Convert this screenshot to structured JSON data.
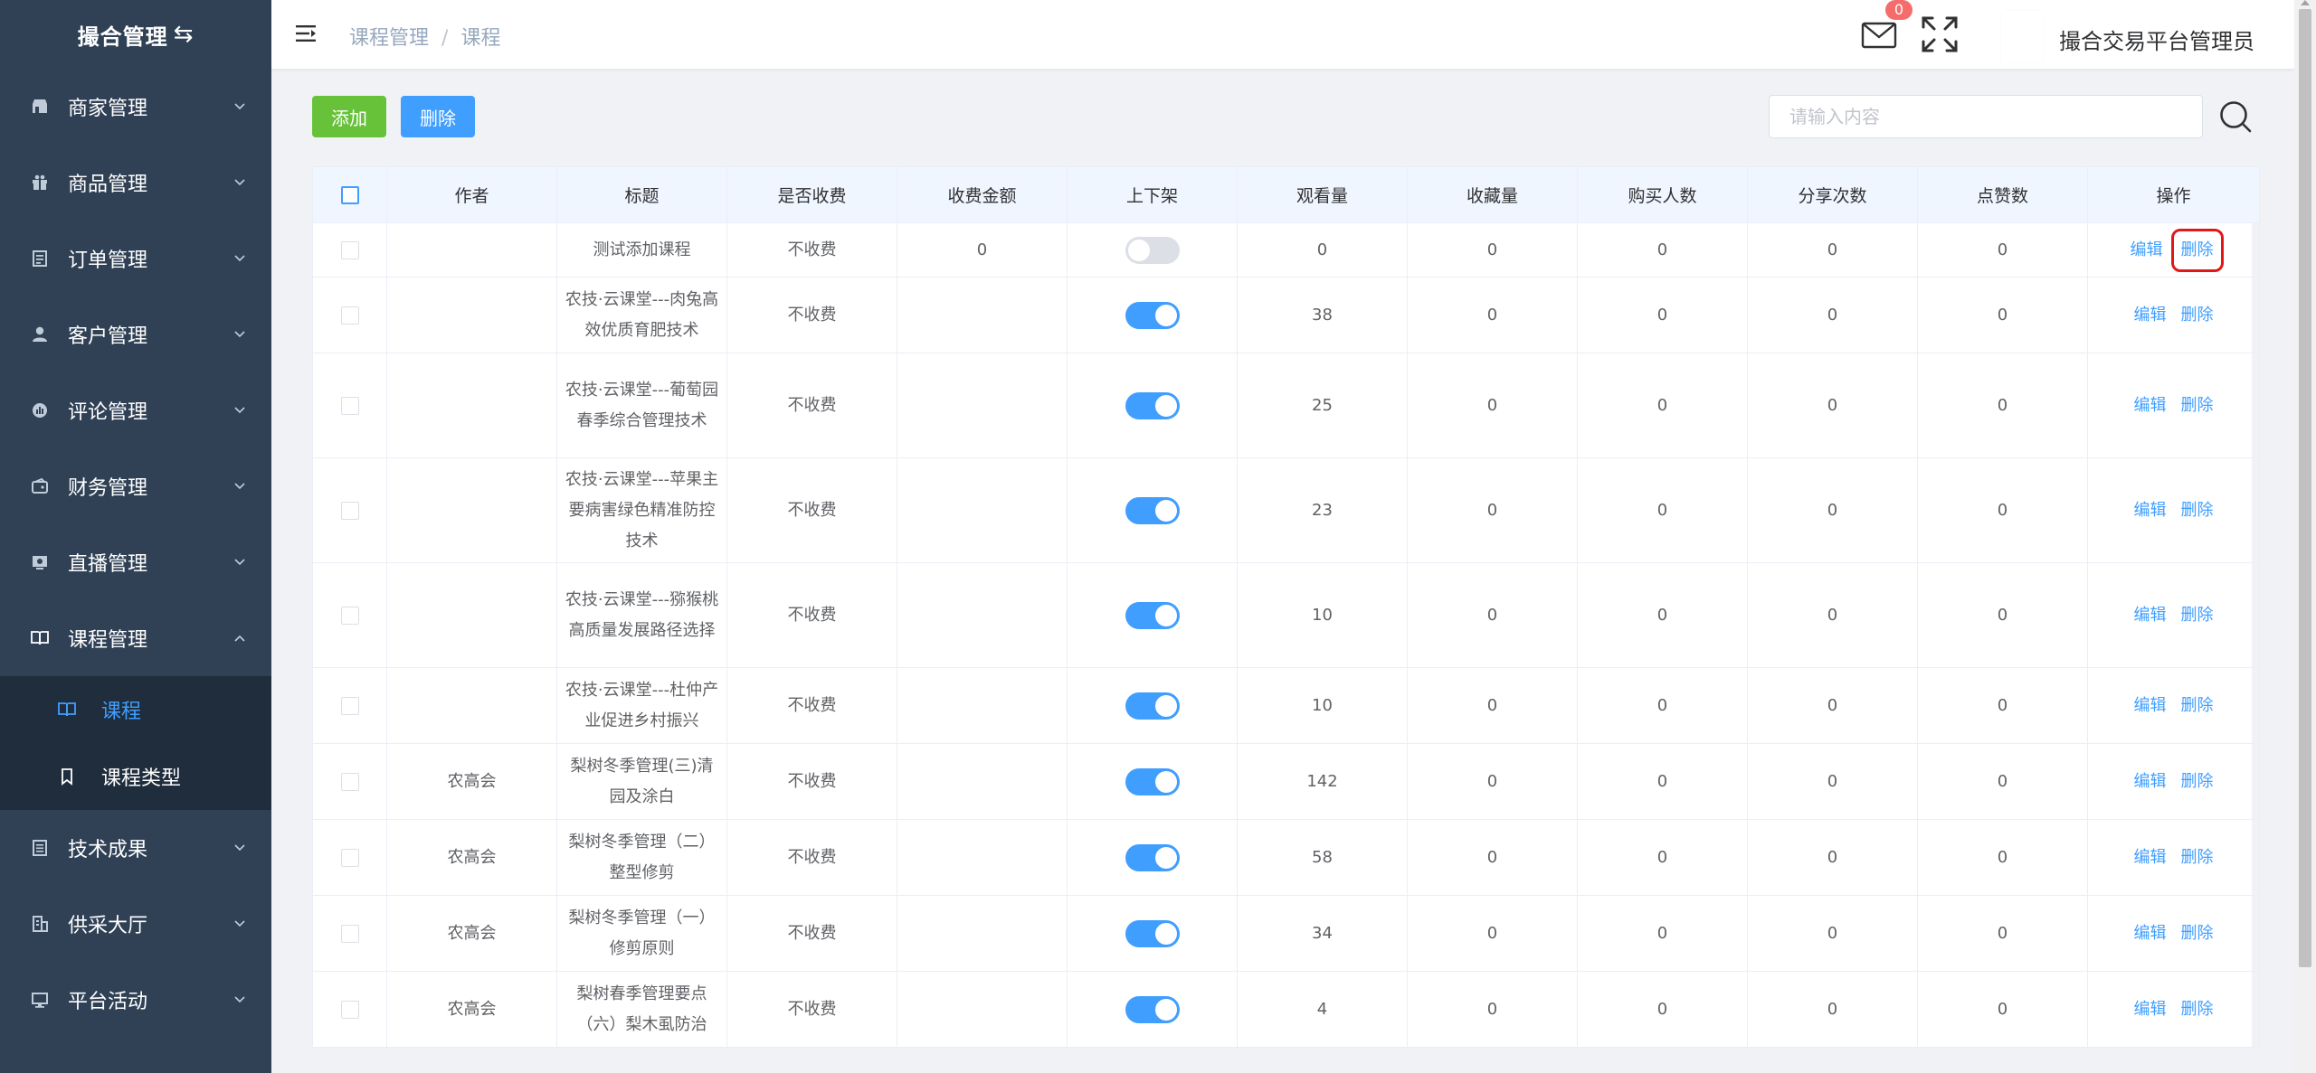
{
  "sidebar": {
    "logo_text": "撮合管理",
    "logo_icon": "swap-arrows-icon",
    "items": [
      {
        "label": "商家管理",
        "icon": "store-icon"
      },
      {
        "label": "商品管理",
        "icon": "gift-icon"
      },
      {
        "label": "订单管理",
        "icon": "order-list-icon"
      },
      {
        "label": "客户管理",
        "icon": "user-icon"
      },
      {
        "label": "评论管理",
        "icon": "comment-icon"
      },
      {
        "label": "财务管理",
        "icon": "wallet-icon"
      },
      {
        "label": "直播管理",
        "icon": "live-icon"
      },
      {
        "label": "课程管理",
        "icon": "book-icon"
      },
      {
        "label": "技术成果",
        "icon": "document-icon"
      },
      {
        "label": "供采大厅",
        "icon": "building-icon"
      },
      {
        "label": "平台活动",
        "icon": "monitor-icon"
      }
    ],
    "sub_items": [
      {
        "label": "课程",
        "icon": "book-open-icon"
      },
      {
        "label": "课程类型",
        "icon": "bookmark-icon"
      }
    ]
  },
  "navbar": {
    "breadcrumb": [
      "课程管理",
      "课程"
    ],
    "mail_badge": "0",
    "username": "撮合交易平台管理员"
  },
  "toolbar": {
    "add_label": "添加",
    "delete_label": "删除",
    "search_placeholder": "请输入内容"
  },
  "table": {
    "headers": [
      "作者",
      "标题",
      "是否收费",
      "收费金额",
      "上下架",
      "观看量",
      "收藏量",
      "购买人数",
      "分享次数",
      "点赞数",
      "操作"
    ],
    "edit_label": "编辑",
    "delete_label": "删除",
    "rows": [
      {
        "author": "",
        "title": "测试添加课程",
        "fee": "不收费",
        "amount": "0",
        "on_shelf": false,
        "views": "0",
        "favorites": "0",
        "buyers": "0",
        "shares": "0",
        "likes": "0"
      },
      {
        "author": "",
        "title": "农技·云课堂---肉兔高效优质育肥技术",
        "fee": "不收费",
        "amount": "",
        "on_shelf": true,
        "views": "38",
        "favorites": "0",
        "buyers": "0",
        "shares": "0",
        "likes": "0"
      },
      {
        "author": "",
        "title": "农技·云课堂---葡萄园春季综合管理技术",
        "fee": "不收费",
        "amount": "",
        "on_shelf": true,
        "views": "25",
        "favorites": "0",
        "buyers": "0",
        "shares": "0",
        "likes": "0"
      },
      {
        "author": "",
        "title": "农技·云课堂---苹果主要病害绿色精准防控技术",
        "fee": "不收费",
        "amount": "",
        "on_shelf": true,
        "views": "23",
        "favorites": "0",
        "buyers": "0",
        "shares": "0",
        "likes": "0"
      },
      {
        "author": "",
        "title": "农技·云课堂---猕猴桃高质量发展路径选择",
        "fee": "不收费",
        "amount": "",
        "on_shelf": true,
        "views": "10",
        "favorites": "0",
        "buyers": "0",
        "shares": "0",
        "likes": "0"
      },
      {
        "author": "",
        "title": "农技·云课堂---杜仲产业促进乡村振兴",
        "fee": "不收费",
        "amount": "",
        "on_shelf": true,
        "views": "10",
        "favorites": "0",
        "buyers": "0",
        "shares": "0",
        "likes": "0"
      },
      {
        "author": "农高会",
        "title": "梨树冬季管理(三)清园及涂白",
        "fee": "不收费",
        "amount": "",
        "on_shelf": true,
        "views": "142",
        "favorites": "0",
        "buyers": "0",
        "shares": "0",
        "likes": "0"
      },
      {
        "author": "农高会",
        "title": "梨树冬季管理（二）整型修剪",
        "fee": "不收费",
        "amount": "",
        "on_shelf": true,
        "views": "58",
        "favorites": "0",
        "buyers": "0",
        "shares": "0",
        "likes": "0"
      },
      {
        "author": "农高会",
        "title": "梨树冬季管理（一）修剪原则",
        "fee": "不收费",
        "amount": "",
        "on_shelf": true,
        "views": "34",
        "favorites": "0",
        "buyers": "0",
        "shares": "0",
        "likes": "0"
      },
      {
        "author": "农高会",
        "title": "梨树春季管理要点（六）梨木虱防治",
        "fee": "不收费",
        "amount": "",
        "on_shelf": true,
        "views": "4",
        "favorites": "0",
        "buyers": "0",
        "shares": "0",
        "likes": "0"
      }
    ]
  },
  "colors": {
    "sidebar_bg": "#304156",
    "submenu_bg": "#1f2d3d",
    "primary": "#409eff",
    "success": "#67c23a",
    "danger": "#f56c6c",
    "highlight_box": "#e01818"
  }
}
